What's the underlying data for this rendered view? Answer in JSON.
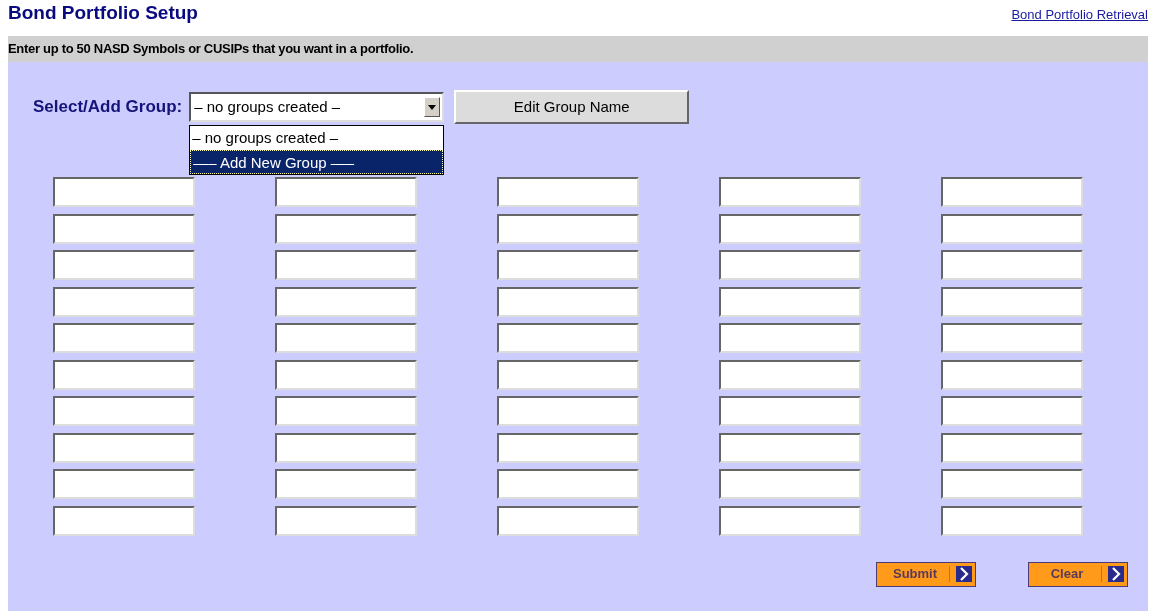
{
  "title": "Bond Portfolio Setup",
  "retrieval_link": "Bond Portfolio Retrieval",
  "instructions": "Enter up to 50 NASD Symbols or CUSIPs that you want in a portfolio.",
  "group_select": {
    "label": "Select/Add Group:",
    "value": "– no groups created –",
    "expanded": true,
    "options": [
      {
        "label": "– no groups created –",
        "highlighted": false
      },
      {
        "label": "—– Add New Group —–",
        "highlighted": true
      }
    ]
  },
  "edit_group_button": "Edit Group Name",
  "symbol_fields": [
    {
      "kind": "text"
    },
    {
      "kind": "text"
    },
    {
      "kind": "text"
    },
    {
      "kind": "text"
    },
    {
      "kind": "text"
    },
    {
      "kind": "text"
    },
    {
      "kind": "text"
    },
    {
      "kind": "text"
    },
    {
      "kind": "text"
    },
    {
      "kind": "text"
    },
    {
      "kind": "text"
    },
    {
      "kind": "text"
    },
    {
      "kind": "text"
    },
    {
      "kind": "text"
    },
    {
      "kind": "text"
    },
    {
      "kind": "text"
    },
    {
      "kind": "text"
    },
    {
      "kind": "text"
    },
    {
      "kind": "text"
    },
    {
      "kind": "text"
    },
    {
      "kind": "text"
    },
    {
      "kind": "text"
    },
    {
      "kind": "text"
    },
    {
      "kind": "text"
    },
    {
      "kind": "text"
    },
    {
      "kind": "text"
    },
    {
      "kind": "text"
    },
    {
      "kind": "text"
    },
    {
      "kind": "text"
    },
    {
      "kind": "text"
    },
    {
      "kind": "text"
    },
    {
      "kind": "text"
    },
    {
      "kind": "text"
    },
    {
      "kind": "text"
    },
    {
      "kind": "text"
    },
    {
      "kind": "text"
    },
    {
      "kind": "text"
    },
    {
      "kind": "text"
    },
    {
      "kind": "text"
    },
    {
      "kind": "text"
    },
    {
      "kind": "text"
    },
    {
      "kind": "text"
    },
    {
      "kind": "text"
    },
    {
      "kind": "text"
    },
    {
      "kind": "text"
    },
    {
      "kind": "text"
    },
    {
      "kind": "text"
    },
    {
      "kind": "text"
    },
    {
      "kind": "text"
    },
    {
      "kind": "text"
    }
  ],
  "buttons": [
    "Submit",
    "Clear"
  ]
}
